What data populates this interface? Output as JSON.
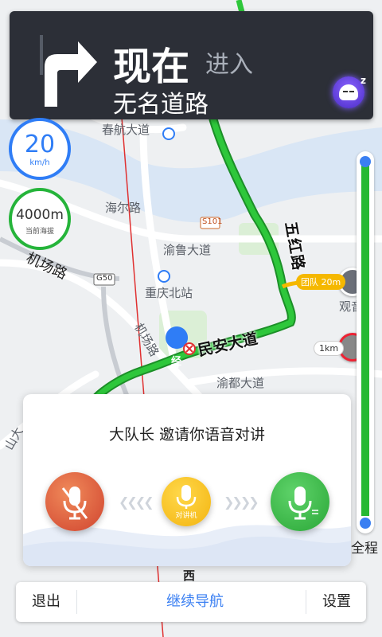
{
  "turn": {
    "distance": "现在",
    "action": "进入",
    "road": "无名道路"
  },
  "speed": {
    "value": "20",
    "unit": "km/h"
  },
  "altitude": {
    "value": "4000m",
    "caption": "当前海拔"
  },
  "map_labels": {
    "hanghang_road": "春航大道",
    "haier_road": "海尔路",
    "s101": "S101",
    "yulu_road": "渝鲁大道",
    "chongqing_north": "重庆北站",
    "airport_road": "机场路",
    "g50": "G50",
    "airport_rd2": "机场路",
    "yudu_road": "渝都大道",
    "minan_road": "民安大道",
    "wuhong_road": "五红路",
    "guan": "观音",
    "west": "西",
    "shan": "山大",
    "jing": "经"
  },
  "markers": {
    "team_tag": "团队 20m",
    "one_km": "1km"
  },
  "progress": {
    "label": "全程"
  },
  "voice": {
    "title": "大队长 邀请你语音对讲",
    "talk_label": "对讲机"
  },
  "bottom_bar": {
    "exit": "退出",
    "continue": "继续导航",
    "settings": "设置"
  },
  "colors": {
    "route_green": "#26b833",
    "accent_blue": "#2f7df6",
    "panel_dark": "#2c2f37"
  }
}
